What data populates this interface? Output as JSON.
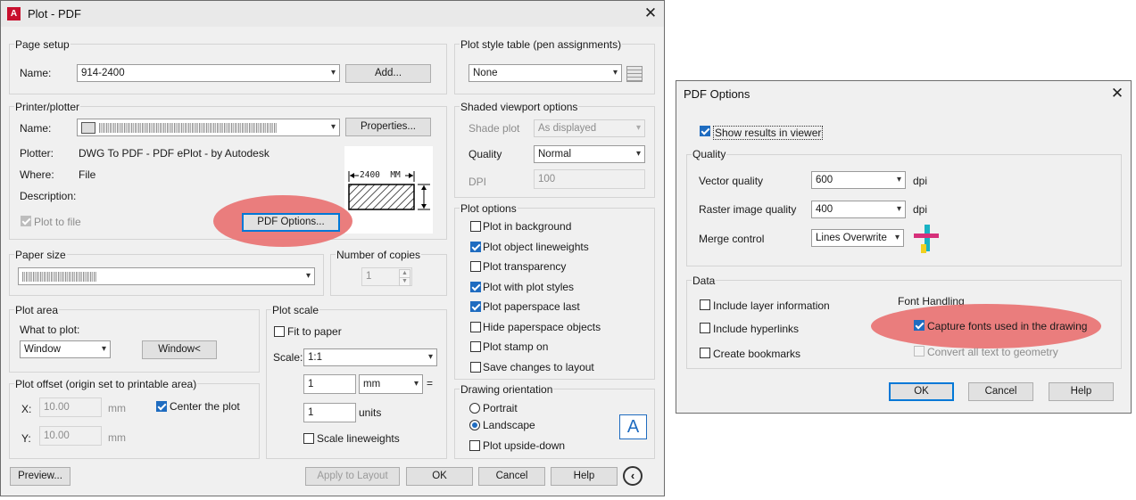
{
  "plot": {
    "title": "Plot - PDF",
    "page_setup": {
      "group": "Page setup",
      "name_label": "Name:",
      "name_value": "914-2400",
      "add_button": "Add..."
    },
    "printer": {
      "group": "Printer/plotter",
      "name_label": "Name:",
      "properties_button": "Properties...",
      "plotter_label": "Plotter:",
      "plotter_value": "DWG To PDF - PDF ePlot - by Autodesk",
      "where_label": "Where:",
      "where_value": "File",
      "description_label": "Description:",
      "plot_to_file": "Plot to file",
      "pdf_options_button": "PDF Options...",
      "preview_dimension": "2400  MM"
    },
    "paper_size": {
      "group": "Paper size"
    },
    "copies": {
      "group": "Number of copies",
      "value": "1"
    },
    "plot_area": {
      "group": "Plot area",
      "what_label": "What to plot:",
      "what_value": "Window",
      "window_button": "Window<"
    },
    "plot_offset": {
      "group": "Plot offset (origin set to printable area)",
      "x_label": "X:",
      "x_value": "10.00",
      "x_unit": "mm",
      "y_label": "Y:",
      "y_value": "10.00",
      "y_unit": "mm",
      "center": "Center the plot"
    },
    "plot_scale": {
      "group": "Plot scale",
      "fit": "Fit to paper",
      "scale_label": "Scale:",
      "scale_value": "1:1",
      "value1": "1",
      "unit1": "mm",
      "equals": "=",
      "value2": "1",
      "unit2": "units",
      "scale_lineweights": "Scale lineweights"
    },
    "style_table": {
      "group": "Plot style table (pen assignments)",
      "value": "None"
    },
    "shaded": {
      "group": "Shaded viewport options",
      "shade_label": "Shade plot",
      "shade_value": "As displayed",
      "quality_label": "Quality",
      "quality_value": "Normal",
      "dpi_label": "DPI",
      "dpi_value": "100"
    },
    "plot_options": {
      "group": "Plot options",
      "items": [
        {
          "label": "Plot in background",
          "checked": false
        },
        {
          "label": "Plot object lineweights",
          "checked": true
        },
        {
          "label": "Plot transparency",
          "checked": false
        },
        {
          "label": "Plot with plot styles",
          "checked": true
        },
        {
          "label": "Plot paperspace last",
          "checked": true
        },
        {
          "label": "Hide paperspace objects",
          "checked": false
        },
        {
          "label": "Plot stamp on",
          "checked": false
        },
        {
          "label": "Save changes to layout",
          "checked": false
        }
      ]
    },
    "orientation": {
      "group": "Drawing orientation",
      "portrait": "Portrait",
      "landscape": "Landscape",
      "upside_down": "Plot upside-down",
      "icon_letter": "A"
    },
    "footer": {
      "preview": "Preview...",
      "apply": "Apply to Layout",
      "ok": "OK",
      "cancel": "Cancel",
      "help": "Help"
    }
  },
  "pdf": {
    "title": "PDF Options",
    "show_results": "Show results in viewer",
    "quality": {
      "group": "Quality",
      "vector_label": "Vector quality",
      "vector_value": "600",
      "vector_unit": "dpi",
      "raster_label": "Raster image quality",
      "raster_value": "400",
      "raster_unit": "dpi",
      "merge_label": "Merge control",
      "merge_value": "Lines Overwrite"
    },
    "data": {
      "group": "Data",
      "layer_info": "Include layer information",
      "hyperlinks": "Include hyperlinks",
      "bookmarks": "Create bookmarks",
      "font_handling": "Font Handling",
      "capture_fonts": "Capture fonts used in the drawing",
      "convert_text": "Convert all text to geometry"
    },
    "footer": {
      "ok": "OK",
      "cancel": "Cancel",
      "help": "Help"
    }
  },
  "colors": {
    "highlight": "#e97676",
    "accent": "#1f6cc0",
    "app_icon": "#c8102e"
  }
}
